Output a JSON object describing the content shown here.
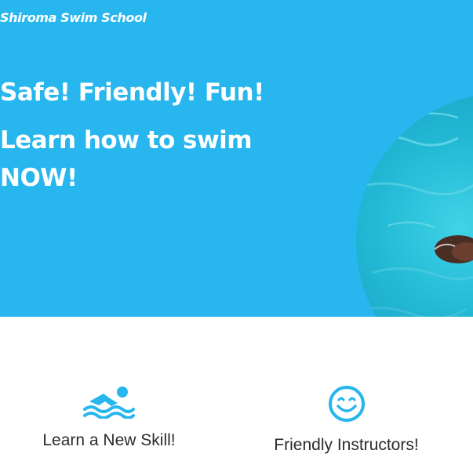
{
  "header": {
    "brand": "Shiroma Swim School"
  },
  "hero": {
    "headline": "Safe! Friendly! Fun!",
    "subheadline_line1": "Learn how to swim",
    "subheadline_line2": "NOW!"
  },
  "features": [
    {
      "icon": "swimmer-icon",
      "title": "Learn a New Skill!"
    },
    {
      "icon": "smile-icon",
      "title": "Friendly Instructors!"
    }
  ],
  "colors": {
    "hero_bg": "#27b6ee",
    "accent": "#27b6ee",
    "text_dark": "#2b2b2b"
  }
}
